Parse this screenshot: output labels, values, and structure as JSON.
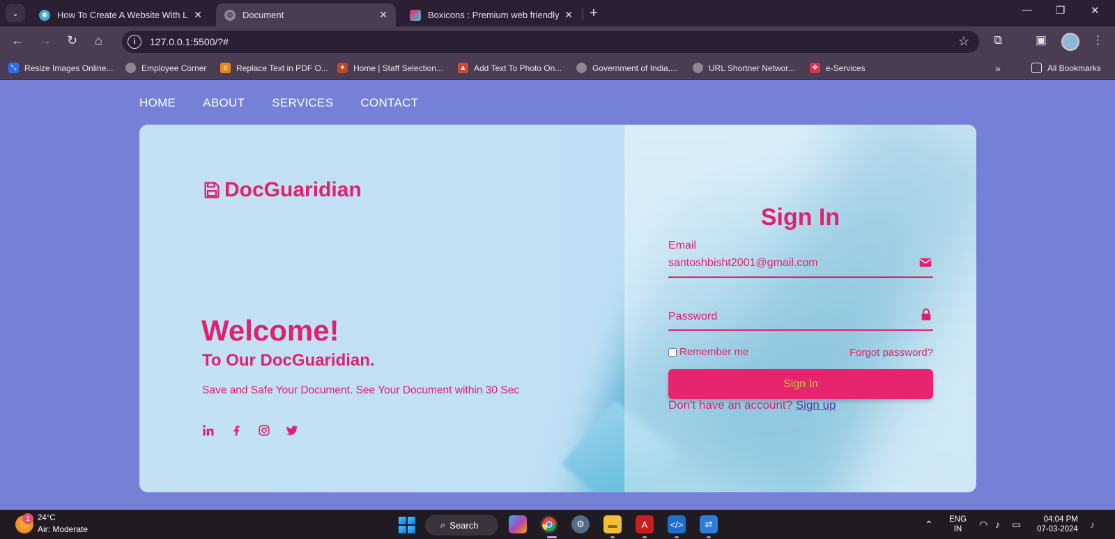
{
  "browser": {
    "tabs": [
      {
        "title": "How To Create A Website With Lo",
        "icon": "site-favicon",
        "active": false
      },
      {
        "title": "Document",
        "icon": "globe-icon",
        "active": true
      },
      {
        "title": "Boxicons : Premium web friendly ic",
        "icon": "boxicons-favicon",
        "active": false
      }
    ],
    "url": "127.0.0.1:5500/?#",
    "bookmarks": [
      "Resize Images Online...",
      "Employee Corner",
      "Replace Text in PDF O...",
      "Home | Staff Selection...",
      "Add Text To Photo On...",
      "Government of India,...",
      "URL Shortner Networ...",
      "e-Services"
    ],
    "all_bookmarks": "All Bookmarks"
  },
  "nav": {
    "items": [
      "HOME",
      "ABOUT",
      "SERVICES",
      "CONTACT"
    ]
  },
  "hero": {
    "logo_text": "DocGuaridian",
    "welcome": "Welcome!",
    "subtitle": "To Our DocGuaridian.",
    "description": "Save and Safe Your Document. See Your Document within 30 Sec",
    "socials": [
      "linkedin-icon",
      "facebook-icon",
      "instagram-icon",
      "twitter-icon"
    ]
  },
  "login": {
    "title": "Sign In",
    "email_label": "Email",
    "email_value": "santoshbisht2001@gmail.com",
    "password_label": "Password",
    "remember_label": "Remember me",
    "forgot_label": "Forgot password?",
    "button_label": "Sign In",
    "no_account_text": "Don't have an account?",
    "signup_label": "Sign up"
  },
  "taskbar": {
    "weather_temp": "24°C",
    "weather_desc": "Air: Moderate",
    "weather_badge": "1",
    "search_label": "Search",
    "lang_top": "ENG",
    "lang_bottom": "IN",
    "time": "04:04 PM",
    "date": "07-03-2024"
  },
  "colors": {
    "accent": "#e0216f",
    "page_bg": "#7580d6",
    "button_text": "#c6c63a"
  }
}
